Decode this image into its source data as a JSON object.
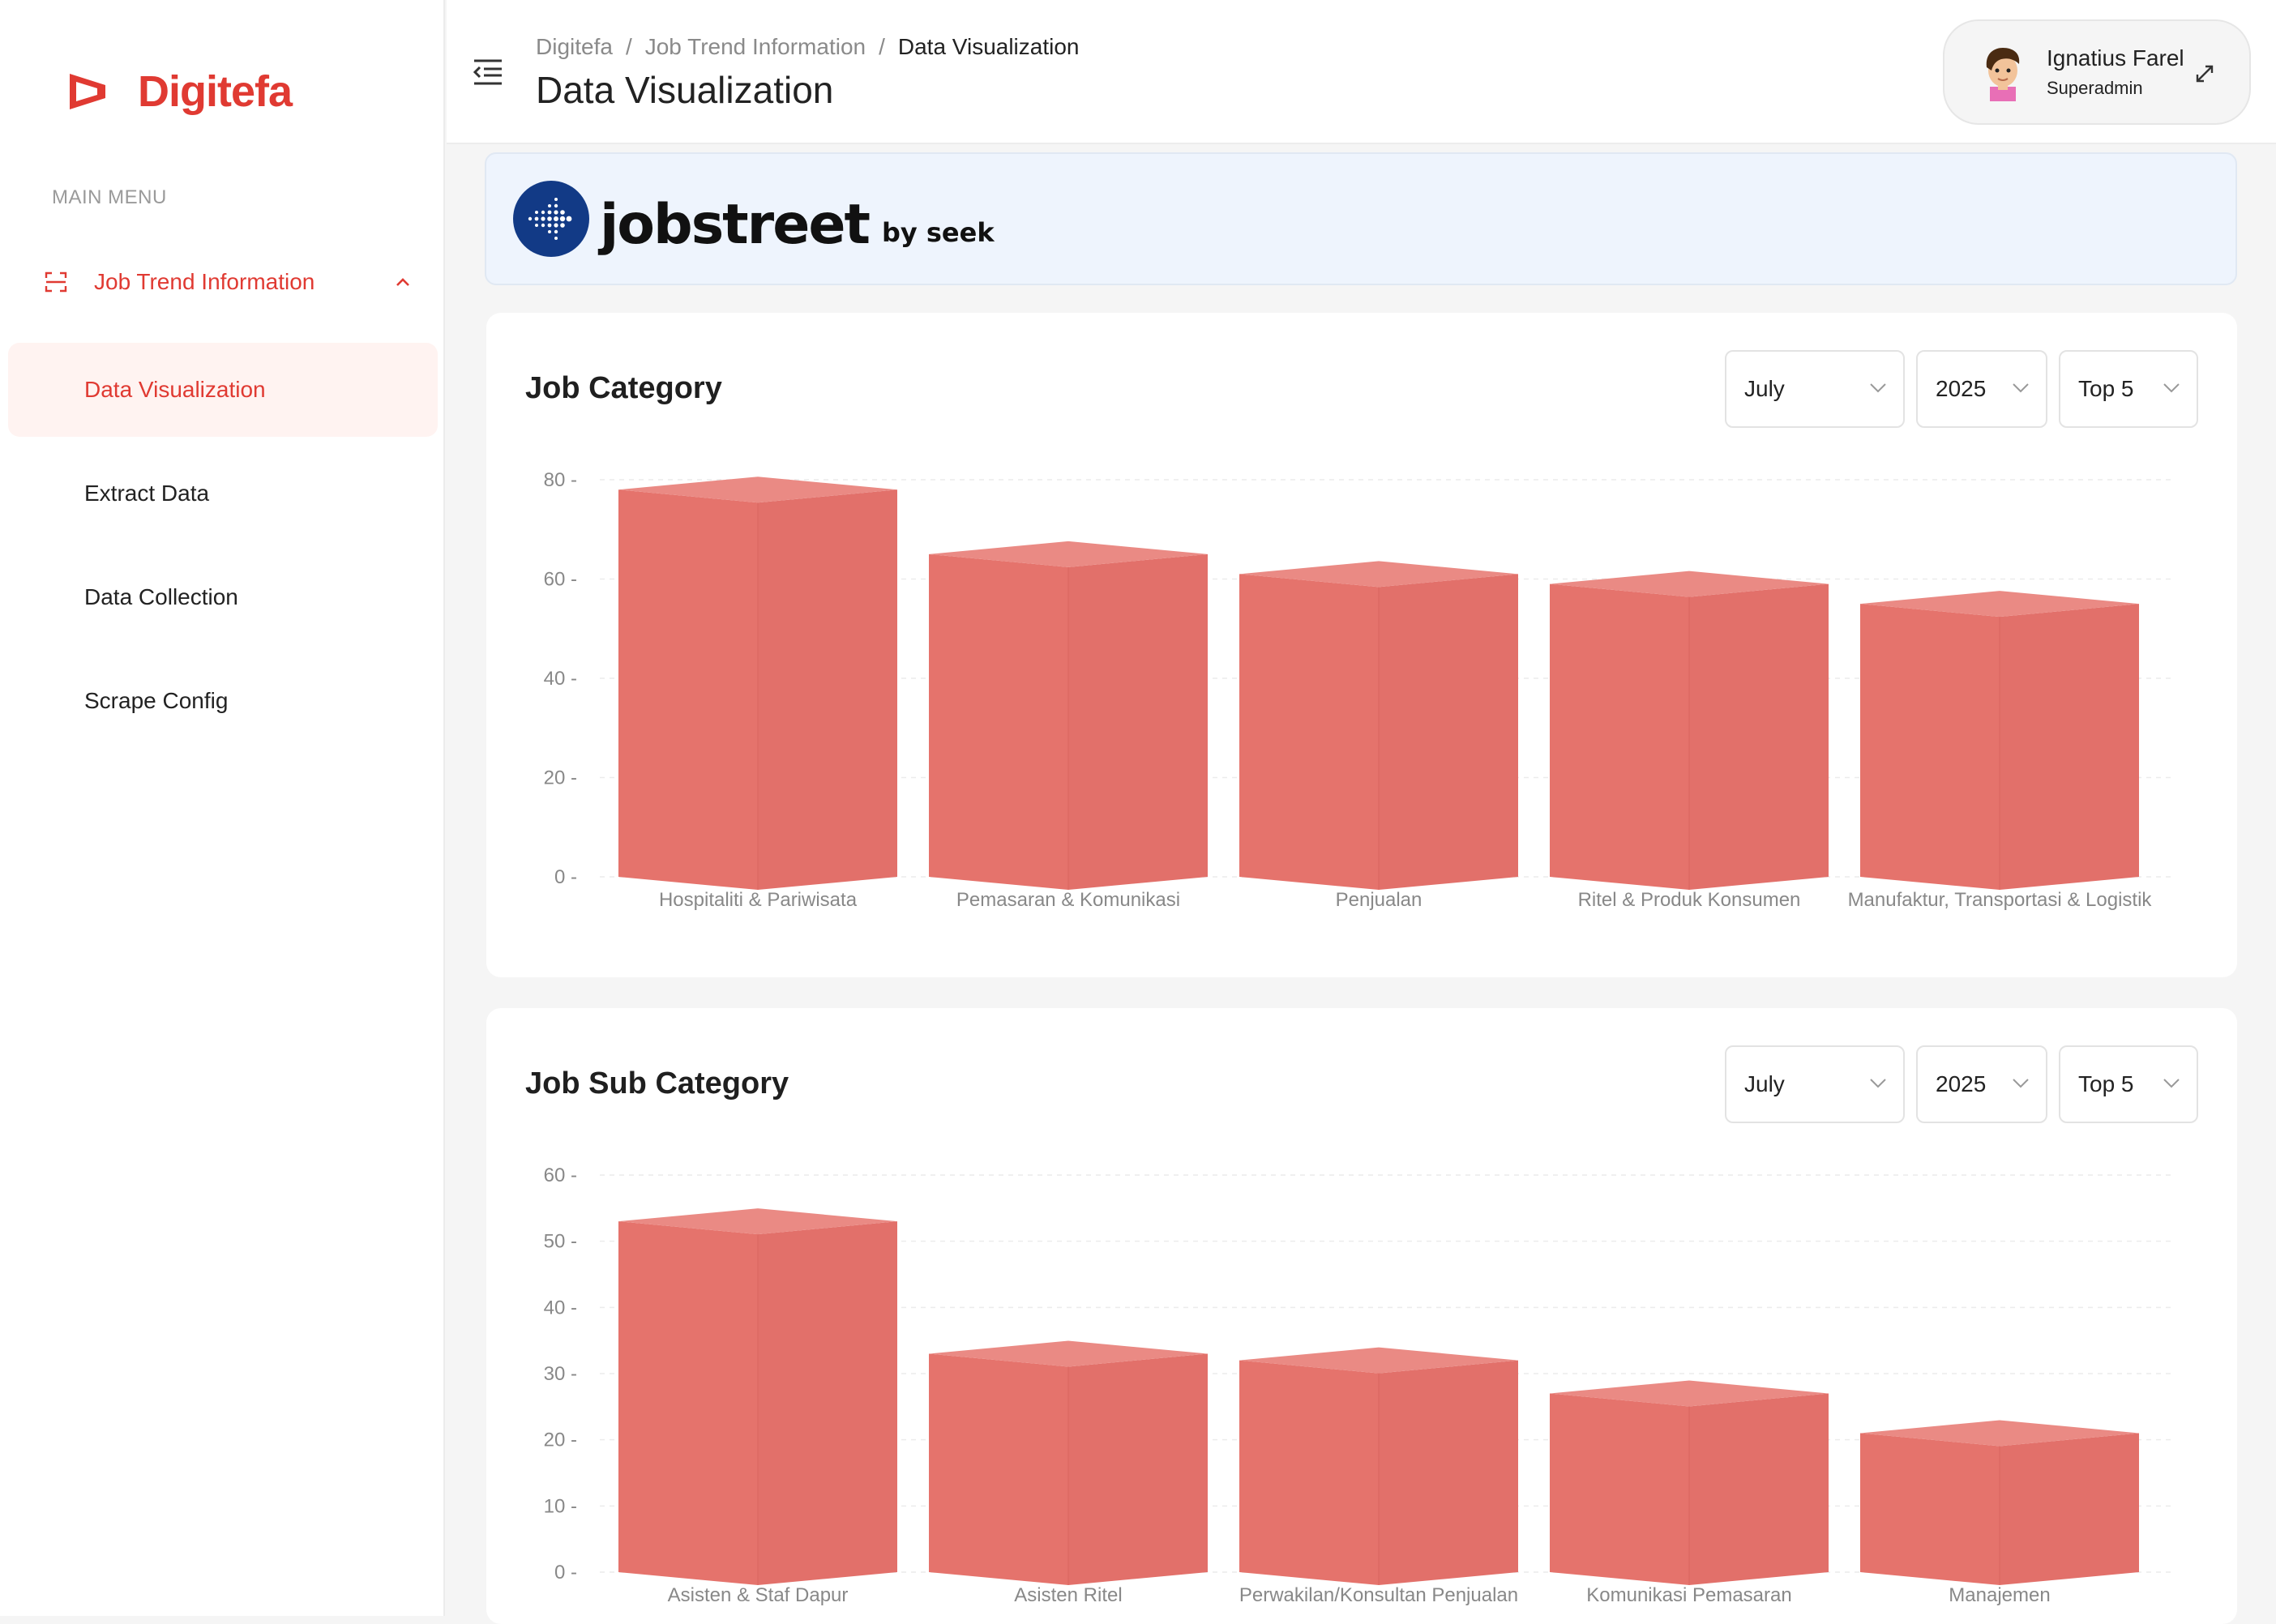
{
  "sidebar": {
    "logo_text": "Digitefa",
    "menu_title": "MAIN MENU",
    "parent_label": "Job Trend Information",
    "items": [
      "Data Visualization",
      "Extract Data",
      "Data Collection",
      "Scrape Config"
    ],
    "active_item": "Data Visualization",
    "brand_color": "#e03a32"
  },
  "header": {
    "breadcrumb": [
      "Digitefa",
      "Job Trend Information",
      "Data Visualization"
    ],
    "title": "Data Visualization",
    "user": {
      "name": "Ignatius Farel",
      "role": "Superadmin"
    }
  },
  "banner": {
    "brand": "jobstreet",
    "suffix": "by seek"
  },
  "cards": [
    {
      "title": "Job Category",
      "filters": {
        "month": "July",
        "year": "2025",
        "top": "Top 5"
      }
    },
    {
      "title": "Job Sub Category",
      "filters": {
        "month": "July",
        "year": "2025",
        "top": "Top 5"
      }
    }
  ],
  "chart_data": [
    {
      "type": "bar",
      "title": "Job Category",
      "categories": [
        "Hospitaliti & Pariwisata",
        "Pemasaran & Komunikasi",
        "Penjualan",
        "Ritel & Produk Konsumen",
        "Manufaktur, Transportasi & Logistik"
      ],
      "values": [
        78,
        65,
        61,
        59,
        55
      ],
      "ylim": [
        0,
        80
      ],
      "yticks": [
        0,
        20,
        40,
        60,
        80
      ],
      "color": "#e5736c",
      "grid": true
    },
    {
      "type": "bar",
      "title": "Job Sub Category",
      "categories": [
        "Asisten & Staf Dapur",
        "Asisten Ritel",
        "Perwakilan/Konsultan Penjualan",
        "Komunikasi Pemasaran",
        "Manajemen"
      ],
      "values": [
        53,
        33,
        32,
        27,
        21
      ],
      "ylim": [
        0,
        60
      ],
      "yticks": [
        0,
        10,
        20,
        30,
        40,
        50,
        60
      ],
      "color": "#e5736c",
      "grid": true
    }
  ]
}
